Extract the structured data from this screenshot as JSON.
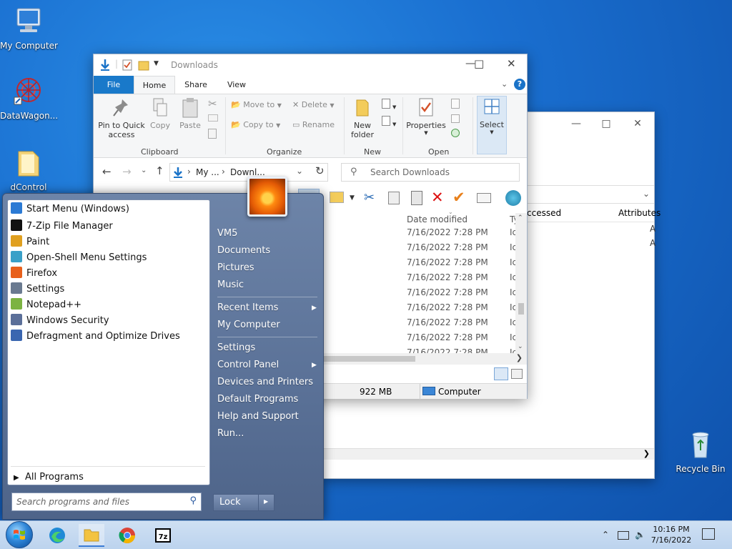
{
  "desktop": {
    "icons": [
      {
        "label": "My Computer"
      },
      {
        "label": "DataWagon..."
      },
      {
        "label": "dControl"
      },
      {
        "label": "Recycle Bin"
      }
    ]
  },
  "explorer": {
    "title": "Downloads",
    "tabs": {
      "file": "File",
      "home": "Home",
      "share": "Share",
      "view": "View"
    },
    "ribbon": {
      "pin": "Pin to Quick access",
      "copy": "Copy",
      "paste": "Paste",
      "move_to": "Move to",
      "copy_to": "Copy to",
      "delete": "Delete",
      "rename": "Rename",
      "new_folder": "New folder",
      "properties": "Properties",
      "select": "Select",
      "groups": {
        "clipboard": "Clipboard",
        "organize": "Organize",
        "new": "New",
        "open": "Open"
      }
    },
    "address": {
      "part1": "My ...",
      "part2": "Downl..."
    },
    "search_placeholder": "Search Downloads",
    "columns": {
      "date_modified": "Date modified",
      "type": "Ty"
    },
    "rows": [
      {
        "date": "7/16/2022 7:28 PM",
        "type": "Ic"
      },
      {
        "date": "7/16/2022 7:28 PM",
        "type": "Ic"
      },
      {
        "date": "7/16/2022 7:28 PM",
        "type": "Ic"
      },
      {
        "date": "7/16/2022 7:28 PM",
        "type": "Ic"
      },
      {
        "date": "7/16/2022 7:28 PM",
        "type": "Ic"
      },
      {
        "date": "7/16/2022 7:28 PM",
        "type": "Ic"
      },
      {
        "date": "7/16/2022 7:28 PM",
        "type": "Ic"
      },
      {
        "date": "7/16/2022 7:28 PM",
        "type": "Ic"
      },
      {
        "date": "7/16/2022 7:28 PM",
        "type": "Ic"
      }
    ],
    "status": {
      "size": "922 MB",
      "location": "Computer"
    }
  },
  "back_window": {
    "columns": {
      "accessed": "ccessed",
      "attributes": "Attributes"
    },
    "attr_values": [
      "A",
      "A"
    ]
  },
  "start_menu": {
    "programs": [
      {
        "label": "Start Menu (Windows)",
        "color": "#2b7ad4"
      },
      {
        "label": "7-Zip File Manager",
        "color": "#111111"
      },
      {
        "label": "Paint",
        "color": "#e0a020"
      },
      {
        "label": "Open-Shell Menu Settings",
        "color": "#3aa0c8"
      },
      {
        "label": "Firefox",
        "color": "#e8601c"
      },
      {
        "label": "Settings",
        "color": "#6a7a90"
      },
      {
        "label": "Notepad++",
        "color": "#7cb342"
      },
      {
        "label": "Windows Security",
        "color": "#5b6f99"
      },
      {
        "label": "Defragment and Optimize Drives",
        "color": "#3a66b0"
      }
    ],
    "all_programs": "All Programs",
    "search_placeholder": "Search programs and files",
    "right_items": {
      "user": "VM5",
      "documents": "Documents",
      "pictures": "Pictures",
      "music": "Music",
      "recent": "Recent Items",
      "computer": "My Computer",
      "settings": "Settings",
      "control_panel": "Control Panel",
      "devices": "Devices and Printers",
      "default_programs": "Default Programs",
      "help": "Help and Support",
      "run": "Run..."
    },
    "lock": "Lock"
  },
  "taskbar": {
    "time": "10:16 PM",
    "date": "7/16/2022"
  }
}
